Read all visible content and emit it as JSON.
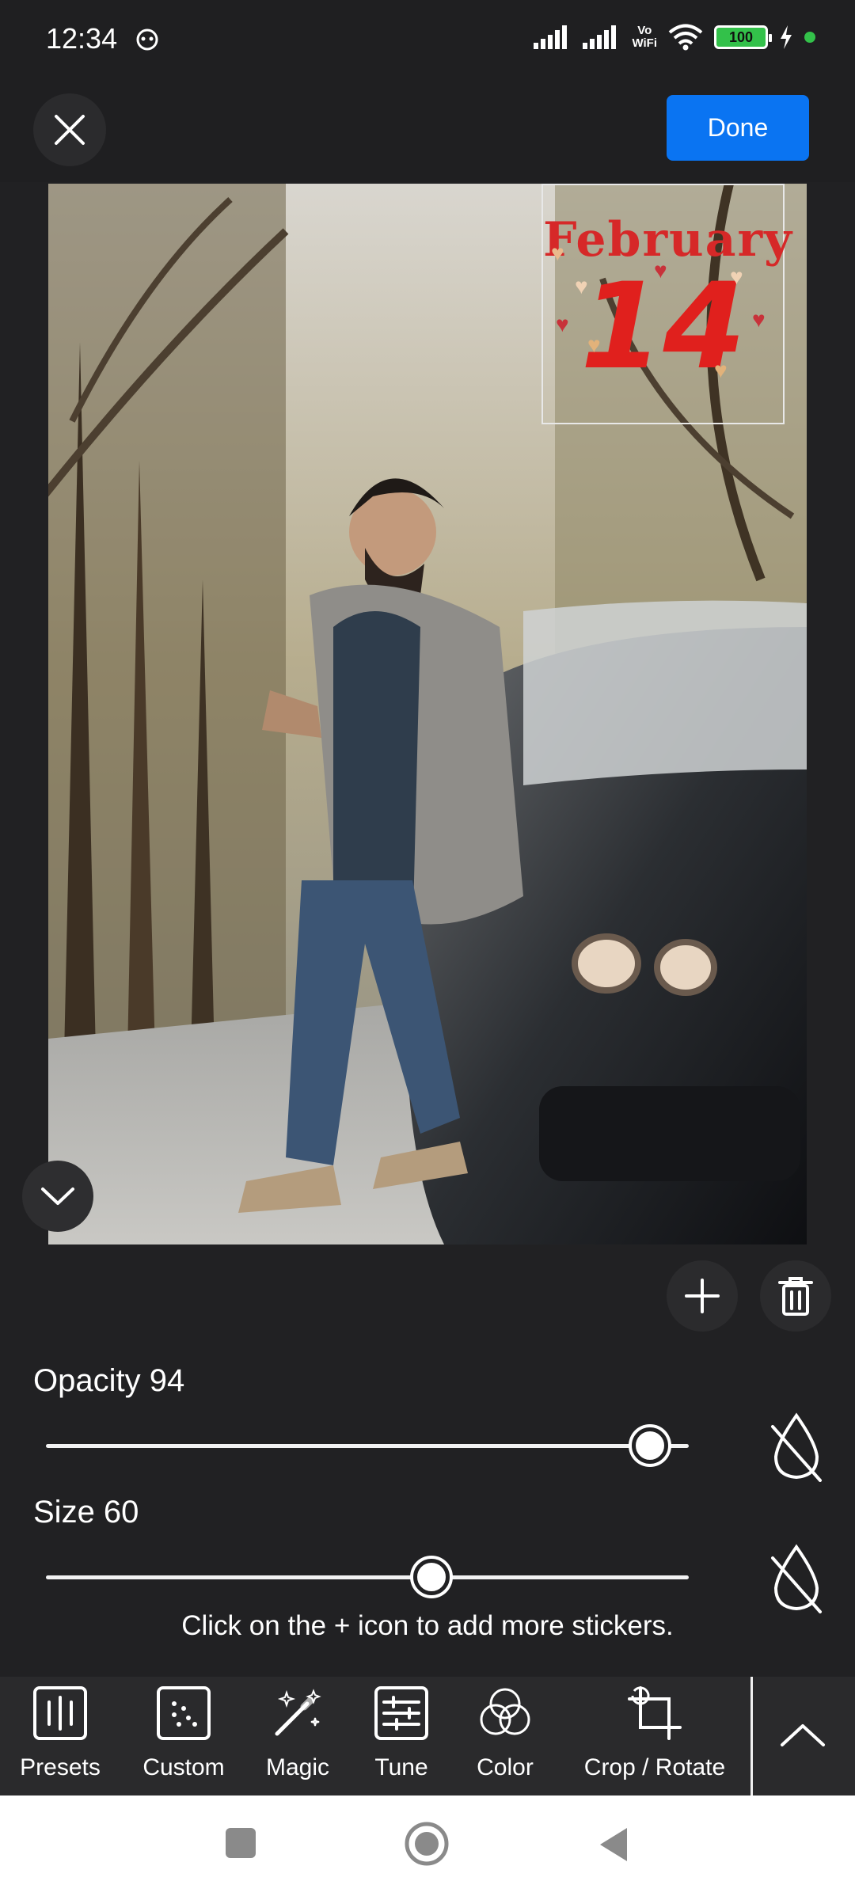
{
  "status_bar": {
    "time": "12:34",
    "network_label_top": "Vo",
    "network_label_bottom": "WiFi",
    "battery": "100",
    "icons": [
      "cat-face-icon",
      "signal-icon",
      "signal-icon",
      "wifi-icon",
      "battery-icon",
      "charging-icon",
      "dot-icon"
    ]
  },
  "header": {
    "close_icon": "close-icon",
    "done_label": "Done"
  },
  "sticker": {
    "month": "February",
    "day": "14"
  },
  "controls": {
    "opacity_label": "Opacity 94",
    "opacity_value": 94,
    "size_label": "Size 60",
    "size_value": 60,
    "hint": "Click on the + icon to add more stickers."
  },
  "toolbar": {
    "items": [
      {
        "label": "Presets",
        "icon": "presets-icon"
      },
      {
        "label": "Custom",
        "icon": "custom-icon"
      },
      {
        "label": "Magic",
        "icon": "magic-wand-icon"
      },
      {
        "label": "Tune",
        "icon": "tune-icon"
      },
      {
        "label": "Color",
        "icon": "color-icon"
      },
      {
        "label": "Crop / Rotate",
        "icon": "crop-rotate-icon"
      }
    ]
  },
  "colors": {
    "background": "#212123",
    "accent": "#0a74f2",
    "sticker_red": "#e0201d"
  }
}
